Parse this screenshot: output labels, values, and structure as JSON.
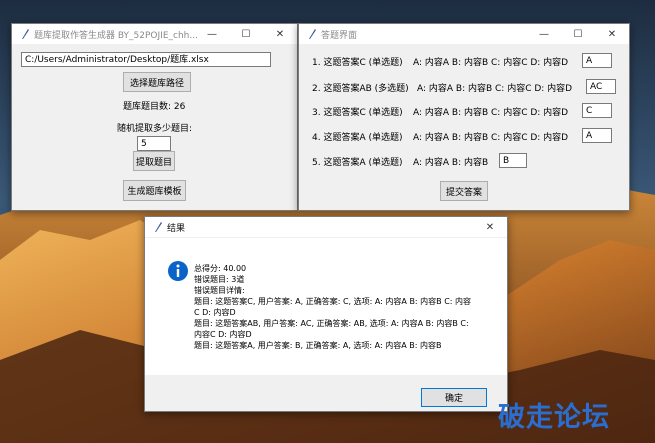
{
  "desktop": {
    "wallpaper": "mountain at sunset"
  },
  "main_window": {
    "title": "题库提取作答生成器 BY_52POJIE_chh...",
    "path_value": "C:/Users/Administrator/Desktop/题库.xlsx",
    "select_path_btn": "选择题库路径",
    "count_label": "题库题目数: 26",
    "extract_prompt": "随机提取多少题目:",
    "extract_value": "5",
    "extract_btn": "提取题目",
    "template_btn": "生成题库模板"
  },
  "answer_window": {
    "title": "答题界面",
    "questions": [
      {
        "label": "1. 这题答案C (单选题)",
        "options": "A: 内容A  B: 内容B  C: 内容C  D: 内容D",
        "answer": "A"
      },
      {
        "label": "2. 这题答案AB (多选题)",
        "options": "A: 内容A  B: 内容B  C: 内容C  D: 内容D",
        "answer": "AC"
      },
      {
        "label": "3. 这题答案C (单选题)",
        "options": "A: 内容A  B: 内容B  C: 内容C  D: 内容D",
        "answer": "C"
      },
      {
        "label": "4. 这题答案A (单选题)",
        "options": "A: 内容A  B: 内容B  C: 内容C  D: 内容D",
        "answer": "A"
      },
      {
        "label": "5. 这题答案A (单选题)",
        "options": "A: 内容A  B: 内容B",
        "answer": "B"
      }
    ],
    "submit_btn": "提交答案"
  },
  "result_window": {
    "title": "结果",
    "lines": [
      "总得分: 40.00",
      "错误题目: 3道",
      "错误题目详情:",
      "题目: 这题答案C, 用户答案: A, 正确答案: C, 选项: A: 内容A  B: 内容B  C: 内容",
      "C  D: 内容D",
      "题目: 这题答案AB, 用户答案: AC, 正确答案: AB, 选项: A: 内容A  B: 内容B  C:",
      "内容C  D: 内容D",
      "题目: 这题答案A, 用户答案: B, 正确答案: A, 选项: A: 内容A  B: 内容B"
    ],
    "ok_btn": "确定"
  },
  "watermark": "破走论坛",
  "colors": {
    "accent": "#0a64c8",
    "watermark": "#2b6ed1"
  }
}
